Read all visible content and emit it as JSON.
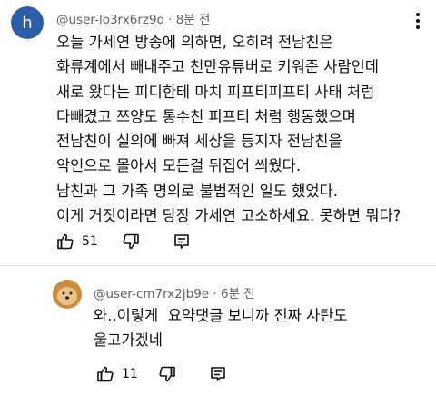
{
  "comments": [
    {
      "author": "@user-lo3rx6rz9o",
      "time": "8분 전",
      "avatar_letter": "h",
      "avatar_color": "#2d5fa8",
      "lines": [
        "오늘 가세연 방송에 의하면, 오히려 전남친은",
        "화류계에서 빼내주고 천만유튜버로 키워준 사람인데",
        "새로 왔다는 피디한테 마치 피프티피프티 사태 처럼",
        "다빼겼고 쯔양도 통수친 피프티 처럼 행동했으며",
        "전남친이 실의에 빠져 세상을 등지자 전남친을",
        "악인으로 몰아서 모든걸 뒤집어 씌웠다.",
        "남친과 그 가족 명의로 불법적인 일도 했었다.",
        "이게 거짓이라면 당장 가세연 고소하세요. 못하면 뭐다?"
      ],
      "likes": "51",
      "icons": [
        "thumb-up-icon",
        "thumb-down-icon",
        "reply-icon",
        "more-vert-icon"
      ]
    },
    {
      "author": "@user-cm7rx2jb9e",
      "time": "6분 전",
      "avatar_color": "#d8a657",
      "lines": [
        "와..이렇게  요약댓글 보니까 진짜 사탄도",
        "울고가겠네"
      ],
      "likes": "11",
      "icons": [
        "thumb-up-icon",
        "thumb-down-icon",
        "reply-icon"
      ]
    }
  ],
  "colors": {
    "meta_text": "#606060",
    "divider": "#e5e5e5"
  }
}
